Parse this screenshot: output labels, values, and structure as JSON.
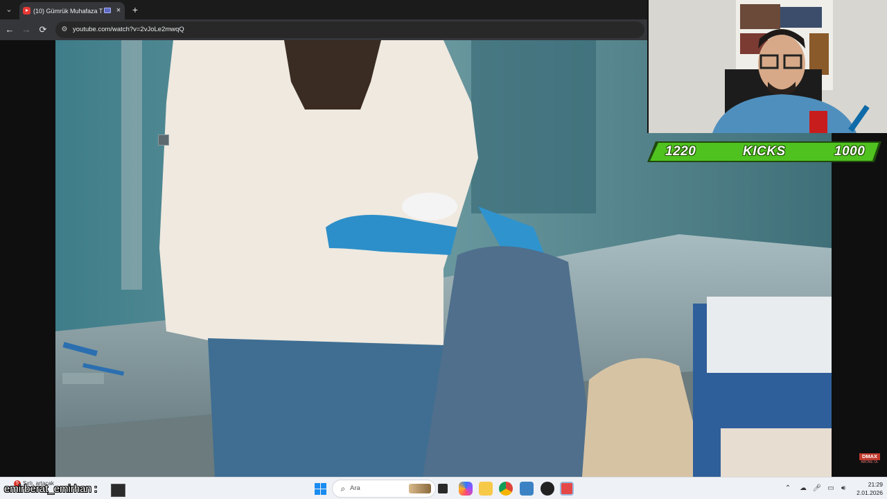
{
  "browser": {
    "tab": {
      "title": "(10) Gümrük Muhafaza Tür",
      "close_icon": "×"
    },
    "tab_search_icon": "⌄",
    "new_tab_icon": "+",
    "nav": {
      "back_icon": "←",
      "forward_icon": "→",
      "reload_icon": "⟳"
    },
    "site_info_icon": "⚙",
    "url": "youtube.com/watch?v=2vJoLe2mwqQ"
  },
  "overlay": {
    "score_left": "1220",
    "score_label": "KICKS",
    "score_right": "1000",
    "watermark_logo": "DMAX",
    "watermark_sub": "ABONE OL"
  },
  "taskbar": {
    "notification_badge": "5",
    "notification_text": "Sırlı, artacak",
    "chat_username": "emirberat_emirhan :",
    "search_icon": "⌕",
    "search_placeholder": "Ara",
    "tray_chevron": "⌃",
    "time": "21:29",
    "date": "2.01.2026"
  },
  "colors": {
    "score_green": "#4fc21f",
    "windows_blue": "#1a8cf0",
    "chrome_dark": "#35363a"
  }
}
